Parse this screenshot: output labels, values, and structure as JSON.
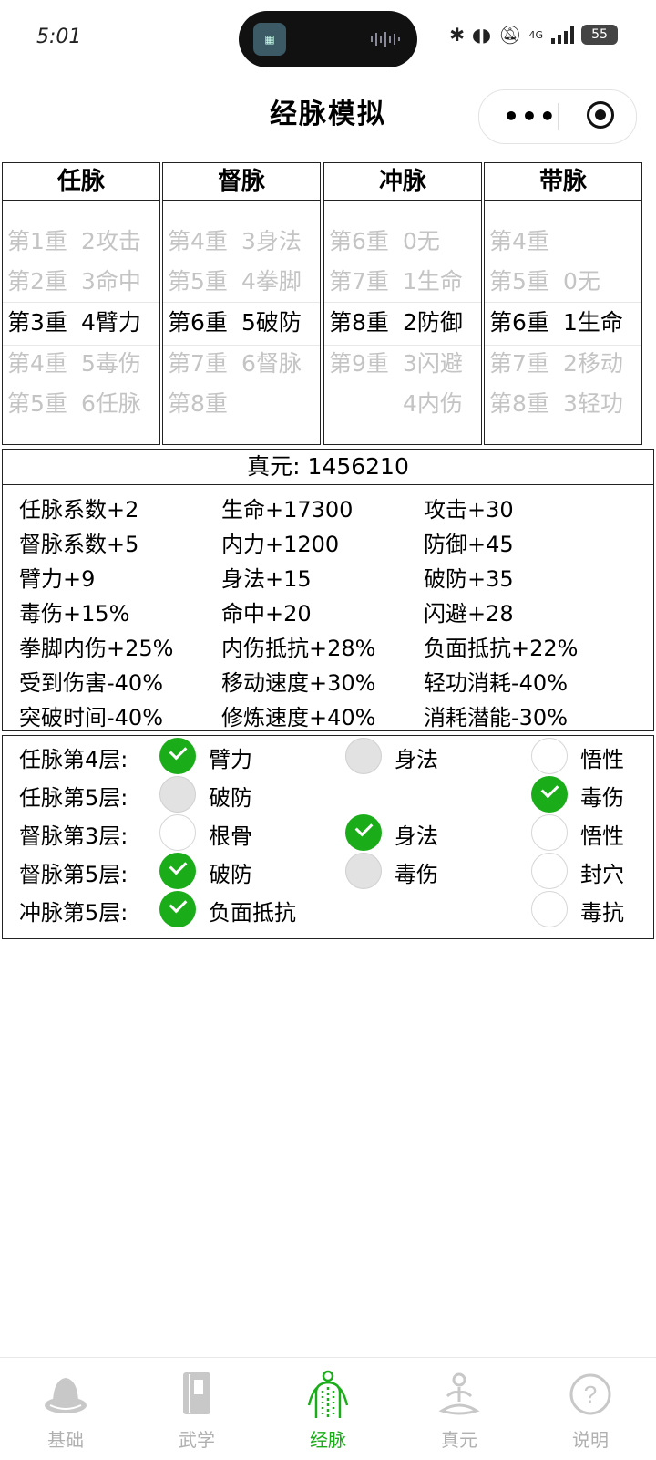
{
  "status_bar": {
    "time": "5:01",
    "network": "4G",
    "battery": "55"
  },
  "nav": {
    "title": "经脉模拟",
    "more_glyph": "•••"
  },
  "meridians": [
    {
      "name": "任脉",
      "rows": [
        {
          "level": "第1重",
          "attr": "2攻击",
          "state": "dim"
        },
        {
          "level": "第2重",
          "attr": "3命中",
          "state": "dim"
        },
        {
          "level": "第3重",
          "attr": "4臂力",
          "state": "sel"
        },
        {
          "level": "第4重",
          "attr": "5毒伤",
          "state": "dim"
        },
        {
          "level": "第5重",
          "attr": "6任脉",
          "state": "dim"
        }
      ]
    },
    {
      "name": "督脉",
      "rows": [
        {
          "level": "第4重",
          "attr": "3身法",
          "state": "dim"
        },
        {
          "level": "第5重",
          "attr": "4拳脚",
          "state": "dim"
        },
        {
          "level": "第6重",
          "attr": "5破防",
          "state": "sel"
        },
        {
          "level": "第7重",
          "attr": "6督脉",
          "state": "dim"
        },
        {
          "level": "第8重",
          "attr": "",
          "state": "dim"
        }
      ]
    },
    {
      "name": "冲脉",
      "rows": [
        {
          "level": "第6重",
          "attr": "0无",
          "state": "dim"
        },
        {
          "level": "第7重",
          "attr": "1生命",
          "state": "dim"
        },
        {
          "level": "第8重",
          "attr": "2防御",
          "state": "sel"
        },
        {
          "level": "第9重",
          "attr": "3闪避",
          "state": "dim"
        },
        {
          "level": "",
          "attr": "4内伤",
          "state": "dim"
        }
      ]
    },
    {
      "name": "带脉",
      "rows": [
        {
          "level": "第4重",
          "attr": "",
          "state": "dim"
        },
        {
          "level": "第5重",
          "attr": "0无",
          "state": "dim"
        },
        {
          "level": "第6重",
          "attr": "1生命",
          "state": "sel"
        },
        {
          "level": "第7重",
          "attr": "2移动",
          "state": "dim"
        },
        {
          "level": "第8重",
          "attr": "3轻功",
          "state": "dim"
        }
      ]
    }
  ],
  "zhenyuan": "真元: 1456210",
  "stats": [
    [
      "任脉系数+2",
      "生命+17300",
      "攻击+30"
    ],
    [
      "督脉系数+5",
      "内力+1200",
      "防御+45"
    ],
    [
      "臂力+9",
      "身法+15",
      "破防+35"
    ],
    [
      "毒伤+15%",
      "命中+20",
      "闪避+28"
    ],
    [
      "拳脚内伤+25%",
      "内伤抵抗+28%",
      "负面抵抗+22%"
    ],
    [
      "受到伤害-40%",
      "移动速度+30%",
      "轻功消耗-40%"
    ],
    [
      "突破时间-40%",
      "修炼速度+40%",
      "消耗潜能-30%"
    ]
  ],
  "choices": [
    {
      "label": "任脉第4层:",
      "options": [
        {
          "text": "臂力",
          "state": "checked",
          "slot": 0
        },
        {
          "text": "身法",
          "state": "disabled",
          "slot": 1
        },
        {
          "text": "悟性",
          "state": "unchecked",
          "slot": 2
        }
      ]
    },
    {
      "label": "任脉第5层:",
      "options": [
        {
          "text": "破防",
          "state": "disabled",
          "slot": 0
        },
        {
          "text": "毒伤",
          "state": "checked",
          "slot": 2
        }
      ]
    },
    {
      "label": "督脉第3层:",
      "options": [
        {
          "text": "根骨",
          "state": "unchecked",
          "slot": 0
        },
        {
          "text": "身法",
          "state": "checked",
          "slot": 1
        },
        {
          "text": "悟性",
          "state": "unchecked",
          "slot": 2
        }
      ]
    },
    {
      "label": "督脉第5层:",
      "options": [
        {
          "text": "破防",
          "state": "checked",
          "slot": 0
        },
        {
          "text": "毒伤",
          "state": "disabled",
          "slot": 1
        },
        {
          "text": "封穴",
          "state": "unchecked",
          "slot": 2
        }
      ]
    },
    {
      "label": "冲脉第5层:",
      "options": [
        {
          "text": "负面抵抗",
          "state": "checked",
          "slot": 0
        },
        {
          "text": "毒抗",
          "state": "unchecked",
          "slot": 2
        }
      ]
    }
  ],
  "tabs": [
    {
      "label": "基础",
      "icon": "hat-icon",
      "active": false
    },
    {
      "label": "武学",
      "icon": "book-icon",
      "active": false
    },
    {
      "label": "经脉",
      "icon": "meridian-body-icon",
      "active": true
    },
    {
      "label": "真元",
      "icon": "meditation-icon",
      "active": false
    },
    {
      "label": "说明",
      "icon": "help-icon",
      "active": false
    }
  ],
  "colors": {
    "accent": "#1aad19",
    "dim_text": "#c4c4c4",
    "inactive_tab": "#b0b0b0"
  }
}
